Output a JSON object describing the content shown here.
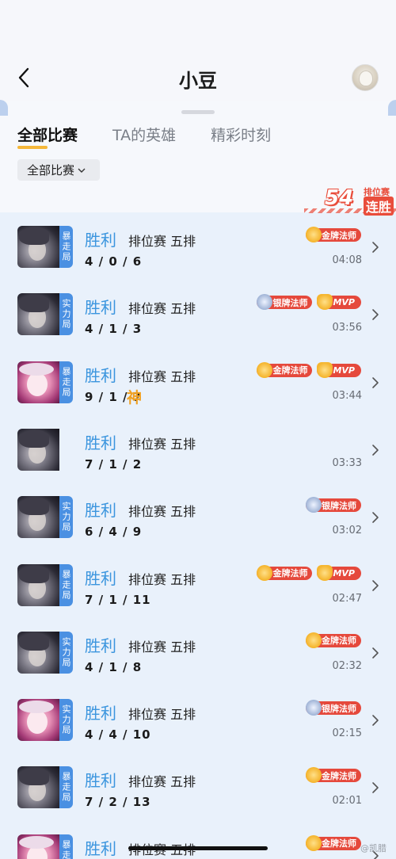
{
  "header": {
    "title": "小豆"
  },
  "tabs": [
    "全部比赛",
    "TA的英雄",
    "精彩时刻"
  ],
  "filter": {
    "label": "全部比赛"
  },
  "streak": {
    "count": "54",
    "label_top": "排位赛",
    "label_bottom": "连胜"
  },
  "matches": [
    {
      "result": "胜利",
      "mode": "排位赛 五排",
      "kda": "4 / 0 / 6",
      "time": "04:08",
      "tag": "暴走局",
      "hero": "dark",
      "badges": [
        {
          "type": "gold",
          "text": "金牌法师"
        }
      ],
      "god": ""
    },
    {
      "result": "胜利",
      "mode": "排位赛 五排",
      "kda": "4 / 1 / 3",
      "time": "03:56",
      "tag": "实力局",
      "hero": "dark",
      "badges": [
        {
          "type": "silver",
          "text": "银牌法师"
        },
        {
          "type": "mvp",
          "text": "MVP"
        }
      ],
      "god": ""
    },
    {
      "result": "胜利",
      "mode": "排位赛 五排",
      "kda": "9 / 1 / 7",
      "time": "03:44",
      "tag": "暴走局",
      "hero": "pink",
      "badges": [
        {
          "type": "gold",
          "text": "金牌法师"
        },
        {
          "type": "mvp",
          "text": "MVP"
        }
      ],
      "god": "神"
    },
    {
      "result": "胜利",
      "mode": "排位赛 五排",
      "kda": "7 / 1 / 2",
      "time": "03:33",
      "tag": "",
      "hero": "dark",
      "badges": [],
      "god": ""
    },
    {
      "result": "胜利",
      "mode": "排位赛 五排",
      "kda": "6 / 4 / 9",
      "time": "03:02",
      "tag": "实力局",
      "hero": "dark",
      "badges": [
        {
          "type": "silver",
          "text": "银牌法师"
        }
      ],
      "god": ""
    },
    {
      "result": "胜利",
      "mode": "排位赛 五排",
      "kda": "7 / 1 / 11",
      "time": "02:47",
      "tag": "暴走局",
      "hero": "dark",
      "badges": [
        {
          "type": "gold",
          "text": "金牌法师"
        },
        {
          "type": "mvp",
          "text": "MVP"
        }
      ],
      "god": ""
    },
    {
      "result": "胜利",
      "mode": "排位赛 五排",
      "kda": "4 / 1 / 8",
      "time": "02:32",
      "tag": "实力局",
      "hero": "dark",
      "badges": [
        {
          "type": "gold",
          "text": "金牌法师"
        }
      ],
      "god": ""
    },
    {
      "result": "胜利",
      "mode": "排位赛 五排",
      "kda": "4 / 4 / 10",
      "time": "02:15",
      "tag": "实力局",
      "hero": "pink",
      "badges": [
        {
          "type": "silver",
          "text": "银牌法师"
        }
      ],
      "god": ""
    },
    {
      "result": "胜利",
      "mode": "排位赛 五排",
      "kda": "7 / 2 / 13",
      "time": "02:01",
      "tag": "暴走局",
      "hero": "dark",
      "badges": [
        {
          "type": "gold",
          "text": "金牌法师"
        }
      ],
      "god": ""
    },
    {
      "result": "胜利",
      "mode": "排位赛 五排",
      "kda": "",
      "time": "",
      "tag": "暴走局",
      "hero": "pink",
      "badges": [
        {
          "type": "gold",
          "text": "金牌法师"
        }
      ],
      "god": ""
    }
  ],
  "watermark": "@凯腊"
}
